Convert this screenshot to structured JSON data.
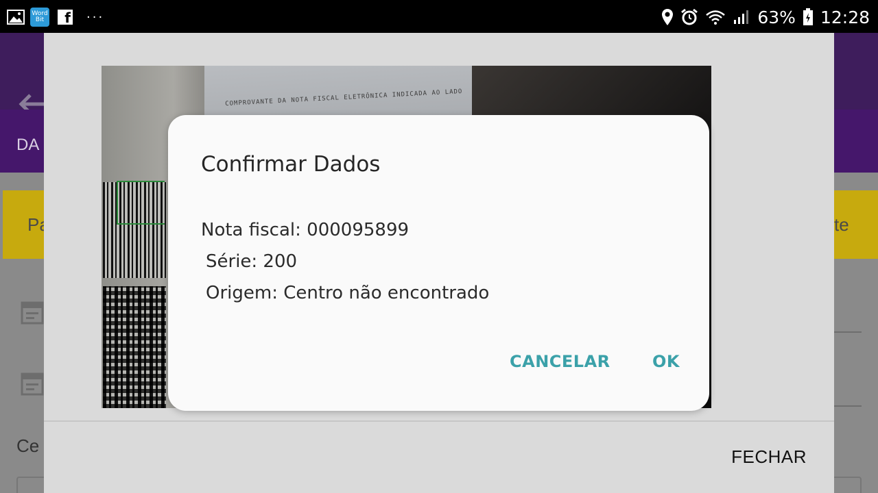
{
  "status_bar": {
    "battery_percent": "63%",
    "time": "12:28",
    "wordbit_label_top": "Word",
    "wordbit_label_bottom": "Bit",
    "facebook_glyph": "f",
    "more_notifications": "···",
    "icons": [
      "gallery-icon",
      "wordbit-app-icon",
      "facebook-icon",
      "location-icon",
      "alarm-icon",
      "wifi-icon",
      "signal-icon",
      "battery-icon"
    ]
  },
  "background_app": {
    "tab_partial": "DA",
    "left_button_partial": "Pa",
    "right_button_partial": "te",
    "field_label_partial": "Ce"
  },
  "scanner_dialog": {
    "close_label": "FECHAR",
    "camera_text_line": "COMPROVANTE DA NOTA FISCAL ELETRÔNICA INDICADA AO LADO"
  },
  "confirm_dialog": {
    "title": "Confirmar Dados",
    "lines": [
      "Nota fiscal: 000095899",
      "Série: 200",
      "Origem: Centro não encontrado"
    ],
    "cancel_label": "CANCELAR",
    "ok_label": "OK"
  },
  "colors": {
    "accent": "#3ba1a9",
    "app_primary": "#45176b",
    "app_yellow": "#c7aa0e"
  }
}
